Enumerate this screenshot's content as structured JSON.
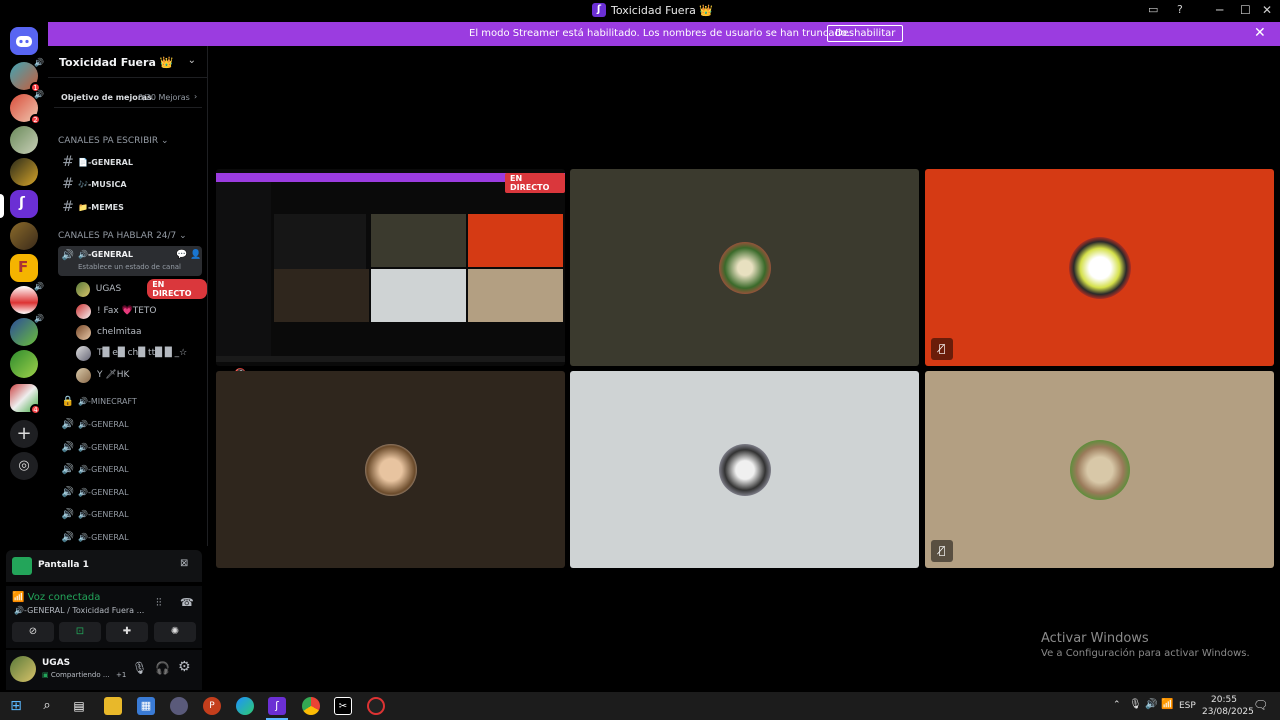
{
  "window": {
    "title": "Toxicidad Fuera 👑",
    "minimize": "─",
    "maximize": "☐",
    "close": "✕"
  },
  "banner": {
    "text": "El modo Streamer está habilitado. Los nombres de usuario se han truncado.",
    "button": "Deshabilitar",
    "close": "✕"
  },
  "rail": {
    "badges": [
      "1",
      "2",
      "4"
    ]
  },
  "server": {
    "name": "Toxicidad Fuera 👑",
    "boost_label": "Objetivo de mejoras",
    "boost_count": "0/20 Mejoras"
  },
  "categories": {
    "text": "CANALES PA ESCRIBIR",
    "voice": "CANALES PA HABLAR 24/7"
  },
  "text_channels": [
    {
      "label": "📄-GENERAL"
    },
    {
      "label": "🎶-MUSICA"
    },
    {
      "label": "📁-MEMES"
    }
  ],
  "active_voice": {
    "label": "🔊-GENERAL",
    "status": "Establece un estado de canal"
  },
  "voice_users": [
    {
      "name": "UGAS",
      "live": "EN DIRECTO"
    },
    {
      "name": "! Fax 💗TETO"
    },
    {
      "name": "chelmitaa"
    },
    {
      "name": "T█ e█ ch█ tt█ █ _☆"
    },
    {
      "name": "Y 🗡HK"
    }
  ],
  "voice_channels": [
    {
      "label": "🔊-MINECRAFT"
    },
    {
      "label": "🔊-GENERAL"
    },
    {
      "label": "🔊-GENERAL"
    },
    {
      "label": "🔊-GENERAL"
    },
    {
      "label": "🔊-GENERAL"
    },
    {
      "label": "🔊-GENERAL"
    },
    {
      "label": "🔊-GENERAL"
    }
  ],
  "screen_panel": {
    "title": "Pantalla 1"
  },
  "voice_panel": {
    "status": "Voz conectada",
    "location": "🔊-GENERAL / Toxicidad Fuera ..."
  },
  "user_panel": {
    "name": "UGAS",
    "status": "Compartiendo ...",
    "extra": "+1"
  },
  "stage": {
    "live_badge": "EN DIRECTO"
  },
  "watermark": {
    "title": "Activar Windows",
    "subtitle": "Ve a Configuración para activar Windows."
  },
  "taskbar": {
    "lang": "ESP",
    "time": "20:55",
    "date": "23/08/2025"
  },
  "colors": {
    "banner": "#9b3ce0",
    "live": "#da373c",
    "voice_connected": "#23a55a",
    "tile_orange": "#d53a14",
    "tile_olive": "#3b3a2e",
    "tile_brown": "#2f261d",
    "tile_grey": "#cfd3d4",
    "tile_tan": "#b39f82"
  }
}
